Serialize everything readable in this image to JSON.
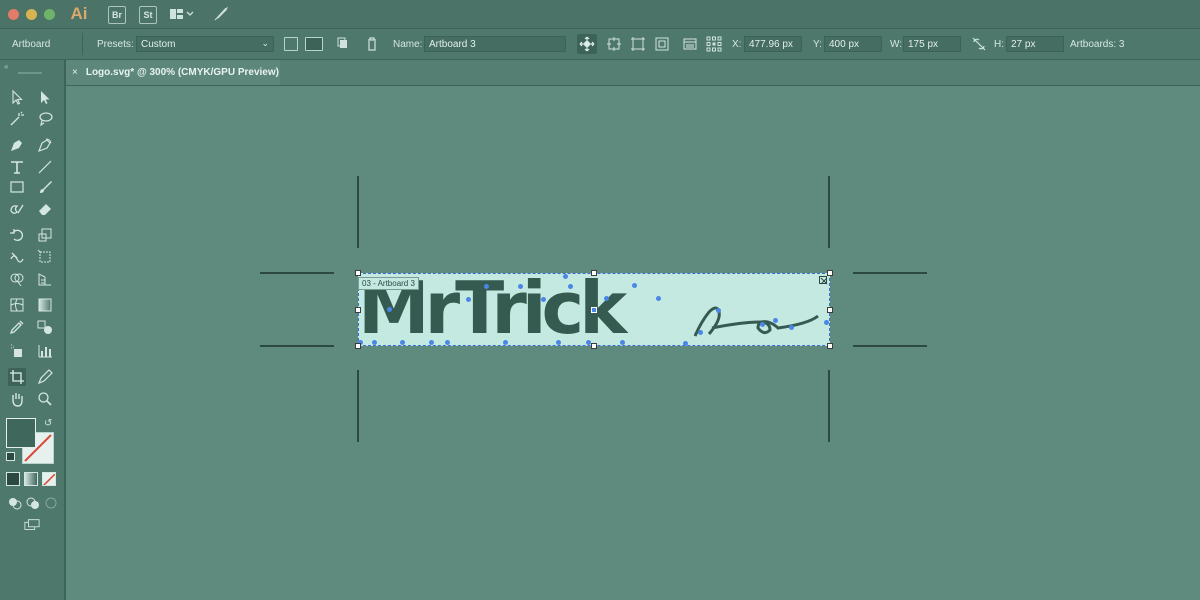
{
  "app": {
    "logo": "Ai",
    "bridge": "Br",
    "stock": "St"
  },
  "controlbar": {
    "mode_label": "Artboard",
    "presets_label": "Presets:",
    "preset_value": "Custom",
    "name_label": "Name:",
    "name_value": "Artboard 3",
    "x_label": "X:",
    "x_value": "477.96 px",
    "y_label": "Y:",
    "y_value": "400 px",
    "w_label": "W:",
    "w_value": "175 px",
    "h_label": "H:",
    "h_value": "27 px",
    "artboards_count": "Artboards: 3"
  },
  "document": {
    "tab_close": "×",
    "tab_title": "Logo.svg* @ 300% (CMYK/GPU Preview)"
  },
  "canvas": {
    "artboard_label": "03 - Artboard 3",
    "logo_text": "MrTrick"
  },
  "colors": {
    "accent": "#4a86e8",
    "artboard_fill": "#c4e9e1",
    "logo_fill": "#355a50",
    "workspace": "#5f8a7e"
  },
  "icons": [
    "selection-icon",
    "direct-selection-icon",
    "magic-wand-icon",
    "lasso-icon",
    "pen-icon",
    "curvature-icon",
    "type-icon",
    "line-icon",
    "rectangle-icon",
    "paintbrush-icon",
    "shaper-icon",
    "eraser-icon",
    "rotate-icon",
    "scale-icon",
    "warp-icon",
    "free-transform-icon",
    "shape-builder-icon",
    "perspective-icon",
    "mesh-icon",
    "gradient-icon",
    "eyedropper-icon",
    "blend-icon",
    "symbol-sprayer-icon",
    "graph-icon",
    "artboard-icon",
    "slice-icon",
    "hand-icon",
    "zoom-icon"
  ]
}
